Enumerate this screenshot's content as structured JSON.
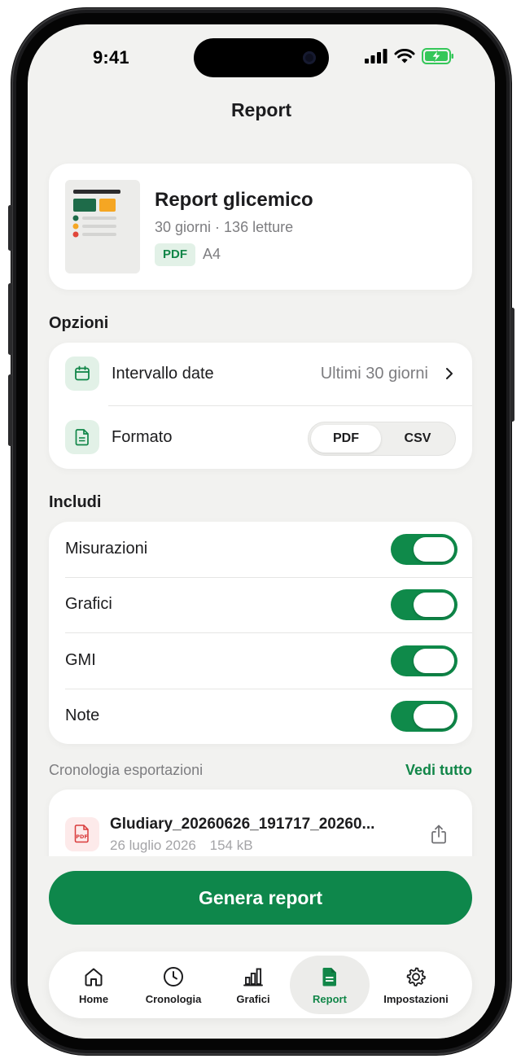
{
  "status_bar": {
    "time": "9:41"
  },
  "nav": {
    "title": "Report"
  },
  "report_card": {
    "title": "Report glicemico",
    "subtitle": "30 giorni · 136 letture",
    "format_badge": "PDF",
    "paper_size": "A4"
  },
  "options": {
    "section_title": "Opzioni",
    "date_range": {
      "label": "Intervallo date",
      "value": "Ultimi 30 giorni"
    },
    "format": {
      "label": "Formato",
      "options": [
        "PDF",
        "CSV"
      ],
      "selected": "PDF"
    }
  },
  "include": {
    "section_title": "Includi",
    "items": [
      {
        "label": "Misurazioni",
        "enabled": true
      },
      {
        "label": "Grafici",
        "enabled": true
      },
      {
        "label": "GMI",
        "enabled": true
      },
      {
        "label": "Note",
        "enabled": true
      }
    ]
  },
  "history": {
    "section_title": "Cronologia esportazioni",
    "see_all": "Vedi tutto",
    "files": [
      {
        "icon_label": "PDF",
        "name": "Gludiary_20260626_191717_20260...",
        "date": "26 luglio 2026",
        "size": "154 kB"
      }
    ]
  },
  "generate_button": {
    "label": "Genera report"
  },
  "tab_bar": {
    "tabs": [
      {
        "label": "Home",
        "icon": "home-icon"
      },
      {
        "label": "Cronologia",
        "icon": "clock-icon"
      },
      {
        "label": "Grafici",
        "icon": "bar-chart-icon"
      },
      {
        "label": "Report",
        "icon": "document-icon",
        "active": true
      },
      {
        "label": "Impostazioni",
        "icon": "gear-icon"
      }
    ]
  },
  "colors": {
    "accent": "#0e874b",
    "accent_light": "#e2f1e7",
    "background": "#f2f2f0"
  }
}
